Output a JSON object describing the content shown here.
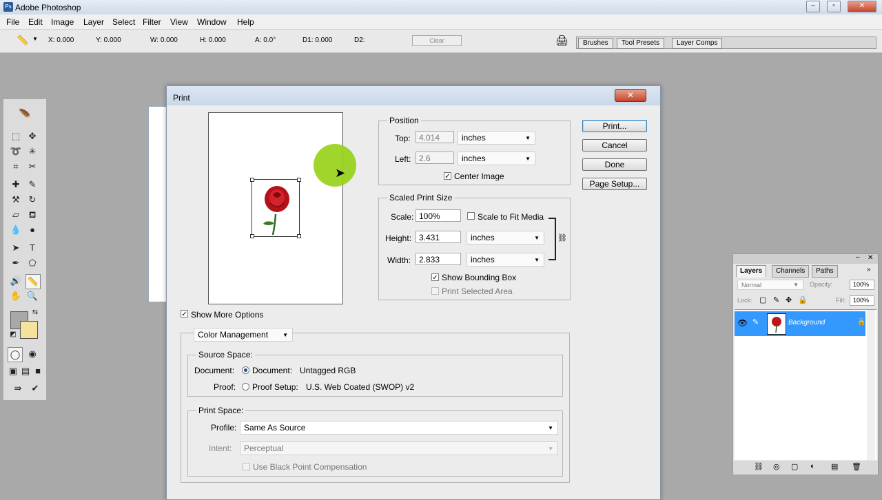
{
  "app": {
    "title": "Adobe Photoshop"
  },
  "menu": [
    "File",
    "Edit",
    "Image",
    "Layer",
    "Select",
    "Filter",
    "View",
    "Window",
    "Help"
  ],
  "options_bar": {
    "x": "X: 0.000",
    "y": "Y: 0.000",
    "w": "W: 0.000",
    "h": "H: 0.000",
    "a": "A: 0.0°",
    "d1": "D1: 0.000",
    "d2": "D2:",
    "clear": "Clear",
    "wells": [
      "Brushes",
      "Tool Presets",
      "Layer Comps"
    ]
  },
  "dialog": {
    "title": "Print",
    "close": "✕",
    "position": {
      "label": "Position",
      "top_label": "Top:",
      "top_value": "4.014",
      "top_unit": "inches",
      "left_label": "Left:",
      "left_value": "2.6",
      "left_unit": "inches",
      "center_label": "Center Image"
    },
    "scaled": {
      "label": "Scaled Print Size",
      "scale_label": "Scale:",
      "scale_value": "100%",
      "fit_label": "Scale to Fit Media",
      "height_label": "Height:",
      "height_value": "3.431",
      "height_unit": "inches",
      "width_label": "Width:",
      "width_value": "2.833",
      "width_unit": "inches",
      "bounding_label": "Show Bounding Box",
      "selected_label": "Print Selected Area"
    },
    "buttons": {
      "print": "Print...",
      "cancel": "Cancel",
      "done": "Done",
      "page_setup": "Page Setup..."
    },
    "more_options": "Show More Options",
    "color_mgmt": "Color Management",
    "source": {
      "label": "Source Space:",
      "document_label": "Document:",
      "document_option": "Document:",
      "document_value": "Untagged RGB",
      "proof_label": "Proof:",
      "proof_option": "Proof Setup:",
      "proof_value": "U.S. Web Coated (SWOP) v2"
    },
    "print_space": {
      "label": "Print Space:",
      "profile_label": "Profile:",
      "profile_value": "Same As Source",
      "intent_label": "Intent:",
      "intent_value": "Perceptual",
      "bpc_label": "Use Black Point Compensation"
    }
  },
  "layers_panel": {
    "tabs": [
      "Layers",
      "Channels",
      "Paths"
    ],
    "blend": "Normal",
    "opacity_label": "Opacity:",
    "opacity_value": "100%",
    "lock_label": "Lock:",
    "fill_label": "Fill:",
    "fill_value": "100%",
    "layer_name": "Background"
  },
  "colors": {
    "accent": "#3399ff",
    "halo": "#96d214",
    "rose": "#c0151a"
  }
}
